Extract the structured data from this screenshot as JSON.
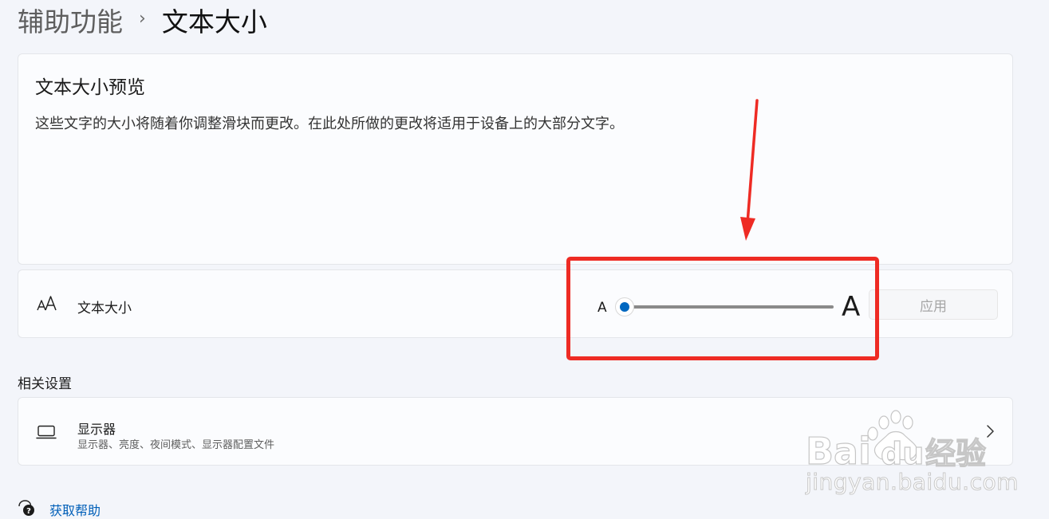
{
  "breadcrumb": {
    "parent": "辅助功能",
    "separator": "›",
    "current": "文本大小"
  },
  "preview": {
    "title": "文本大小预览",
    "description": "这些文字的大小将随着你调整滑块而更改。在此处所做的更改将适用于设备上的大部分文字。"
  },
  "text_size": {
    "icon": "text-size-icon",
    "label": "文本大小",
    "slider": {
      "min_label": "A",
      "max_label": "A",
      "value_fraction": 0.0
    },
    "apply_label": "应用"
  },
  "related": {
    "heading": "相关设置",
    "items": [
      {
        "icon": "laptop-icon",
        "title": "显示器",
        "subtitle": "显示器、亮度、夜间模式、显示器配置文件"
      }
    ]
  },
  "help": {
    "icon": "help-icon",
    "label": "获取帮助"
  },
  "watermark": {
    "brand": "Baidu经验",
    "url": "jingyan.baidu.com"
  },
  "colors": {
    "accent": "#0067c0",
    "highlight": "#ee2b24",
    "link": "#005fb8",
    "background": "#f3f5fa"
  }
}
